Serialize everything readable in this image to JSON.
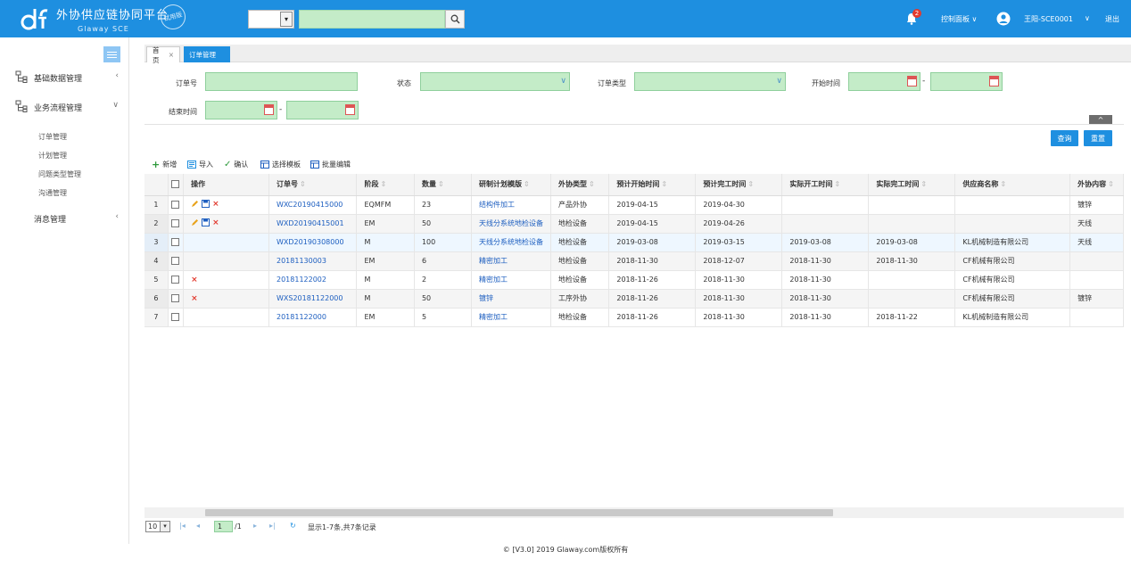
{
  "header": {
    "title": "外协供应链协同平台",
    "subtitle": "Glaway SCE",
    "trial_badge": "试用版",
    "search_select_value": "",
    "search_value": "",
    "notification_count": "2",
    "control_panel": "控制面板",
    "user": "王阳-SCE0001",
    "logout": "退出"
  },
  "sidebar": {
    "groups": [
      {
        "label": "基础数据管理"
      },
      {
        "label": "业务流程管理"
      },
      {
        "label": "消息管理"
      }
    ],
    "sub_items": [
      "订单管理",
      "计划管理",
      "问题类型管理",
      "沟通管理"
    ]
  },
  "tabs": [
    {
      "label": "首页"
    },
    {
      "label": "订单管理"
    }
  ],
  "filters": {
    "order_no": "订单号",
    "status": "状态",
    "order_type": "订单类型",
    "start_time": "开始时间",
    "end_time": "结束时间",
    "range_sep": "-"
  },
  "buttons": {
    "query": "查询",
    "reset": "重置",
    "collapse": "^"
  },
  "toolbar": {
    "add": "新增",
    "import": "导入",
    "confirm": "确认",
    "select_template": "选择模板",
    "batch_edit": "批量编辑"
  },
  "table": {
    "columns": [
      "操作",
      "订单号",
      "阶段",
      "数量",
      "研制计划模版",
      "外协类型",
      "预计开始时间",
      "预计完工时间",
      "实际开工时间",
      "实际完工时间",
      "供应商名称",
      "外协内容"
    ],
    "rows": [
      {
        "n": "1",
        "ops": "edit",
        "order": "WXC20190415000",
        "stage": "EQMFM",
        "qty": "23",
        "tpl": "结构件加工",
        "type": "产品外协",
        "ps": "2019-04-15",
        "pe": "2019-04-30",
        "as": "",
        "ae": "",
        "supplier": "",
        "content": "镀锌"
      },
      {
        "n": "2",
        "ops": "edit",
        "order": "WXD20190415001",
        "stage": "EM",
        "qty": "50",
        "tpl": "天线分系统地检设备",
        "type": "地检设备",
        "ps": "2019-04-15",
        "pe": "2019-04-26",
        "as": "",
        "ae": "",
        "supplier": "",
        "content": "天线"
      },
      {
        "n": "3",
        "ops": "",
        "order": "WXD20190308000",
        "stage": "M",
        "qty": "100",
        "tpl": "天线分系统地检设备",
        "type": "地检设备",
        "ps": "2019-03-08",
        "pe": "2019-03-15",
        "as": "2019-03-08",
        "ae": "2019-03-08",
        "supplier": "KL机械制造有限公司",
        "content": "天线"
      },
      {
        "n": "4",
        "ops": "",
        "order": "20181130003",
        "stage": "EM",
        "qty": "6",
        "tpl": "精密加工",
        "type": "地检设备",
        "ps": "2018-11-30",
        "pe": "2018-12-07",
        "as": "2018-11-30",
        "ae": "2018-11-30",
        "supplier": "CF机械有限公司",
        "content": ""
      },
      {
        "n": "5",
        "ops": "delete",
        "order": "20181122002",
        "stage": "M",
        "qty": "2",
        "tpl": "精密加工",
        "type": "地检设备",
        "ps": "2018-11-26",
        "pe": "2018-11-30",
        "as": "2018-11-30",
        "ae": "",
        "supplier": "CF机械有限公司",
        "content": ""
      },
      {
        "n": "6",
        "ops": "delete",
        "order": "WXS20181122000",
        "stage": "M",
        "qty": "50",
        "tpl": "镀锌",
        "type": "工序外协",
        "ps": "2018-11-26",
        "pe": "2018-11-30",
        "as": "2018-11-30",
        "ae": "",
        "supplier": "CF机械有限公司",
        "content": "镀锌"
      },
      {
        "n": "7",
        "ops": "",
        "order": "20181122000",
        "stage": "EM",
        "qty": "5",
        "tpl": "精密加工",
        "type": "地检设备",
        "ps": "2018-11-26",
        "pe": "2018-11-30",
        "as": "2018-11-30",
        "ae": "2018-11-22",
        "supplier": "KL机械制造有限公司",
        "content": ""
      }
    ]
  },
  "pager": {
    "page_size": "10",
    "current_page": "1",
    "total_pages": "/1",
    "summary": "显示1-7条,共7条记录"
  },
  "footer": "© [V3.0] 2019 Glaway.com版权所有",
  "colors": {
    "primary": "#1e8fe0",
    "input_green": "#c4ecc8",
    "link": "#1e5fc0",
    "delete": "#e23a2e"
  }
}
